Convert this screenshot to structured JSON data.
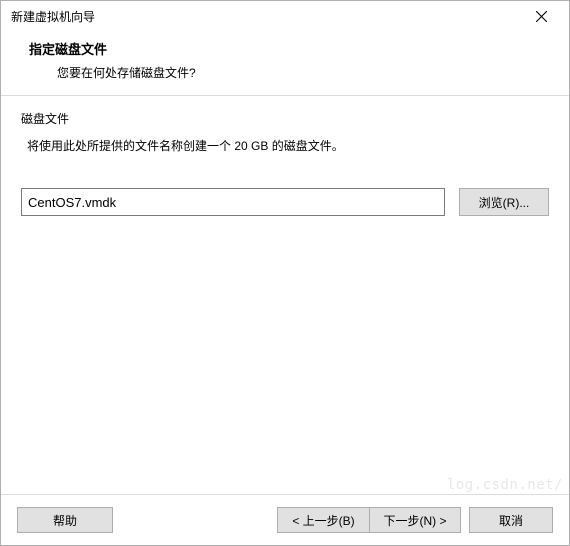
{
  "titlebar": {
    "title": "新建虚拟机向导"
  },
  "header": {
    "heading": "指定磁盘文件",
    "subheading": "您要在何处存储磁盘文件?"
  },
  "content": {
    "section_label": "磁盘文件",
    "section_desc": "将使用此处所提供的文件名称创建一个 20 GB 的磁盘文件。",
    "file_value": "CentOS7.vmdk",
    "browse_label": "浏览(R)..."
  },
  "footer": {
    "help": "帮助",
    "back": "< 上一步(B)",
    "next": "下一步(N) >",
    "cancel": "取消"
  },
  "watermark": "log.csdn.net/"
}
